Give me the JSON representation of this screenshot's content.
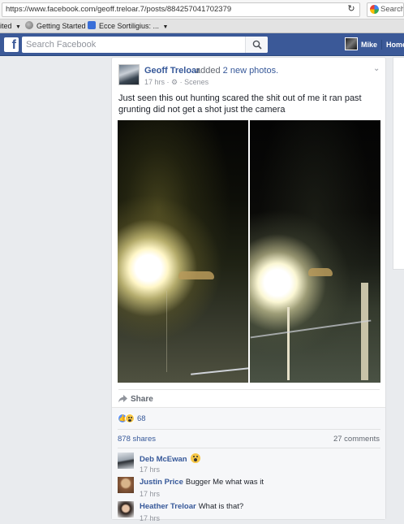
{
  "browser": {
    "url": "https://www.facebook.com/geoff.treloar.7/posts/884257041702379",
    "search_label": "Search",
    "bookmarks": [
      {
        "label": "ited",
        "icon": "caret-down-icon"
      },
      {
        "label": "Getting Started",
        "icon": "globe-icon"
      },
      {
        "label": "Ecce Sortiligius: ...",
        "icon": "rss-icon"
      }
    ]
  },
  "fb_header": {
    "logo": "f",
    "search_placeholder": "Search Facebook",
    "user_name": "Mike",
    "home_label": "Home"
  },
  "post": {
    "author": "Geoff Treloar",
    "action_prefix": "added",
    "action_link": "2 new photos.",
    "time": "17 hrs",
    "audience": "Scenes",
    "text": "Just seen this out hunting scared the shit out of me it ran past grunting did not get a shot just the camera",
    "share_label": "Share"
  },
  "feedback": {
    "reaction_count": "68",
    "shares": "878 shares",
    "comments_count": "27 comments"
  },
  "comments": [
    {
      "name": "Deb McEwan",
      "text": "",
      "time": "17 hrs",
      "emoji": "wow-emoji"
    },
    {
      "name": "Justin Price",
      "text": "Bugger Me what was it",
      "time": "17 hrs"
    },
    {
      "name": "Heather Treloar",
      "text": "What is that?",
      "time": "17 hrs"
    }
  ],
  "colors": {
    "fb_blue": "#3b5998",
    "link_blue": "#365899",
    "page_bg": "#e9ebee"
  }
}
